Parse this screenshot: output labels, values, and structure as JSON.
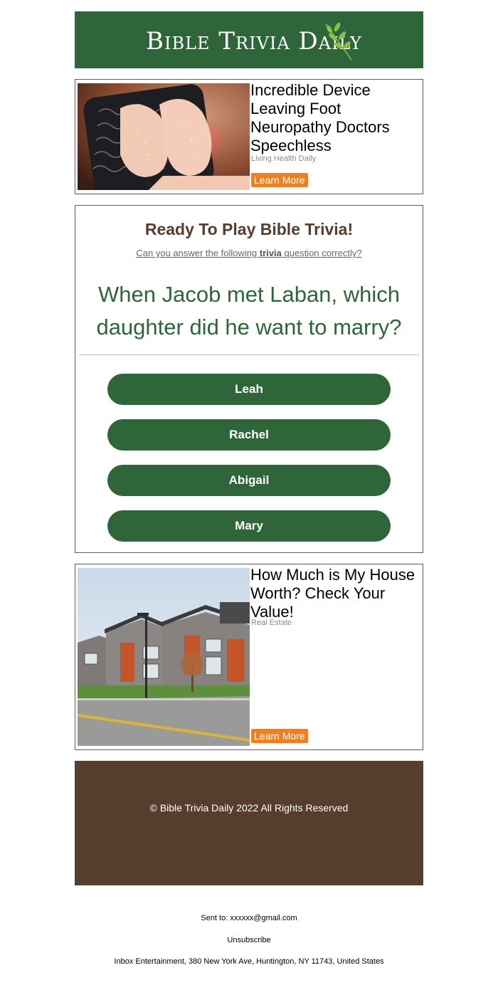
{
  "header": {
    "logo_text": "Bible Trivia Daily",
    "bg_color": "#2e6539"
  },
  "ads": [
    {
      "title": "Incredible Device Leaving Foot Neuropathy Doctors Speechless",
      "source": "Living Health Daily",
      "cta": "Learn More",
      "image": "foot-massager-image"
    },
    {
      "title": "How Much is My House Worth? Check Your Value!",
      "source": "Real Estate",
      "cta": "Learn More",
      "image": "suburban-houses-image"
    }
  ],
  "trivia": {
    "heading": "Ready To Play Bible Trivia!",
    "sub_prefix": "Can you answer the following ",
    "sub_bold": "trivia",
    "sub_suffix": " question correctly?",
    "question": "When Jacob met Laban, which daughter did he want to marry?",
    "answers": [
      "Leah",
      "Rachel",
      "Abigail",
      "Mary"
    ]
  },
  "footer": {
    "copyright": "© Bible Trivia Daily 2022 All Rights Reserved",
    "bg_color": "#573d2d"
  },
  "fine_print": {
    "sent_to": "Sent to: xxxxxx@gmail.com",
    "unsubscribe": "Unsubscribe",
    "address": "Inbox Entertainment, 380 New York Ave, Huntington, NY 11743, United States"
  },
  "colors": {
    "accent_orange": "#f0801e",
    "brand_green": "#2e6539",
    "brown": "#573d2d"
  }
}
